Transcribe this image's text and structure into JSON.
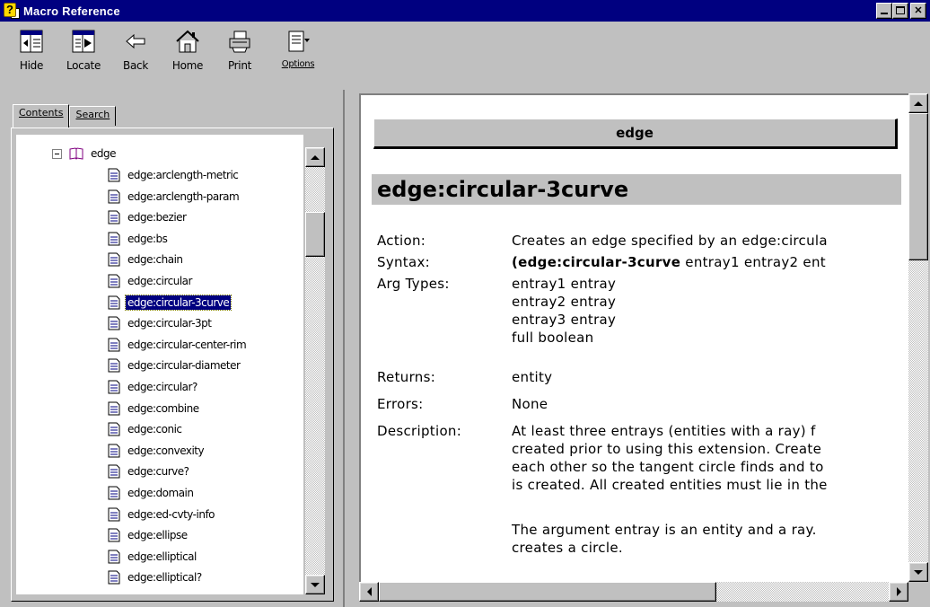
{
  "window": {
    "title": "Macro Reference"
  },
  "toolbar": {
    "hide": "Hide",
    "locate": "Locate",
    "back": "Back",
    "home": "Home",
    "print": "Print",
    "options": "Options"
  },
  "tabs": {
    "contents": "Contents",
    "search": "Search"
  },
  "tree": {
    "root": "edge",
    "items": [
      "edge:arclength-metric",
      "edge:arclength-param",
      "edge:bezier",
      "edge:bs",
      "edge:chain",
      "edge:circular",
      "edge:circular-3curve",
      "edge:circular-3pt",
      "edge:circular-center-rim",
      "edge:circular-diameter",
      "edge:circular?",
      "edge:combine",
      "edge:conic",
      "edge:convexity",
      "edge:curve?",
      "edge:domain",
      "edge:ed-cvty-info",
      "edge:ellipse",
      "edge:elliptical",
      "edge:elliptical?"
    ],
    "selected_index": 6
  },
  "content": {
    "banner": "edge",
    "heading": "edge:circular-3curve",
    "action_label": "Action:",
    "action": "Creates an edge specified by an edge:circula",
    "syntax_label": "Syntax:",
    "syntax_bold": "(edge:circular-3curve",
    "syntax_rest": " entray1 entray2 ent",
    "argtypes_label": "Arg Types:",
    "argtypes": [
      "entray1 entray",
      "entray2 entray",
      "entray3 entray",
      "full boolean"
    ],
    "returns_label": "Returns:",
    "returns": "entity",
    "errors_label": "Errors:",
    "errors": "None",
    "description_label": "Description:",
    "description": [
      "At least three entrays (entities with a ray) f",
      "created prior to using this extension. Create",
      "each other so the tangent circle finds and to",
      "is created. All created entities must lie in the",
      "",
      "The argument entray is an entity and a ray.",
      "creates a circle."
    ]
  }
}
